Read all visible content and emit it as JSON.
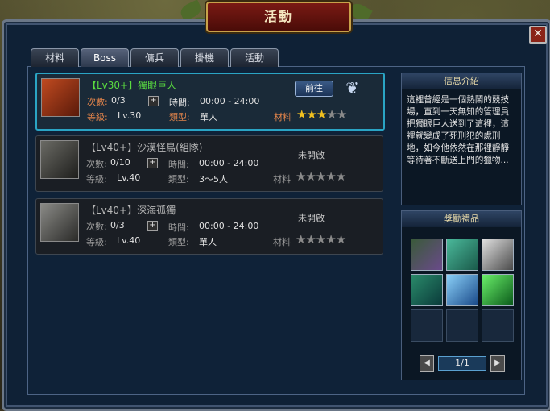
{
  "window": {
    "title": "活動",
    "close_label": "✕"
  },
  "tabs": [
    {
      "label": "材料"
    },
    {
      "label": "Boss"
    },
    {
      "label": "傭兵"
    },
    {
      "label": "掛機"
    },
    {
      "label": "活動"
    }
  ],
  "bosses": [
    {
      "name": "【Lv30+】獨眼巨人",
      "count_label": "次數:",
      "count_value": "0/3",
      "time_label": "時間:",
      "time_value": "00:00 - 24:00",
      "level_label": "等級:",
      "level_value": "Lv.30",
      "type_label": "類型:",
      "type_value": "單人",
      "material_label": "材料",
      "stars": 3,
      "go_label": "前往",
      "status": ""
    },
    {
      "name": "【Lv40+】沙漠怪鳥(組隊)",
      "count_label": "次數:",
      "count_value": "0/10",
      "time_label": "時間:",
      "time_value": "00:00 - 24:00",
      "level_label": "等級:",
      "level_value": "Lv.40",
      "type_label": "類型:",
      "type_value": "3～5人",
      "material_label": "材料",
      "stars": 5,
      "go_label": "",
      "status": "未開啟"
    },
    {
      "name": "【Lv40+】深海孤獨",
      "count_label": "次數:",
      "count_value": "0/3",
      "time_label": "時間:",
      "time_value": "00:00 - 24:00",
      "level_label": "等級:",
      "level_value": "Lv.40",
      "type_label": "類型:",
      "type_value": "單人",
      "material_label": "材料",
      "stars": 3,
      "go_label": "",
      "status": "未開啟"
    }
  ],
  "info": {
    "title": "信息介紹",
    "text": "這裡曾經是一個熱鬧的競技場，直到一天無知的管理員把獨眼巨人送到了這裡，這裡就變成了死刑犯的處刑地，如今他依然在那裡靜靜等待著不斷送上門的獵物..."
  },
  "rewards": {
    "title": "獎勵禮品",
    "page": "1/1",
    "items": [
      {
        "icon": "armor-icon"
      },
      {
        "icon": "green-ingot-icon"
      },
      {
        "icon": "silver-ore-icon"
      },
      {
        "icon": "card-icon"
      },
      {
        "icon": "blue-crystal-icon"
      },
      {
        "icon": "green-gem-icon"
      }
    ]
  }
}
